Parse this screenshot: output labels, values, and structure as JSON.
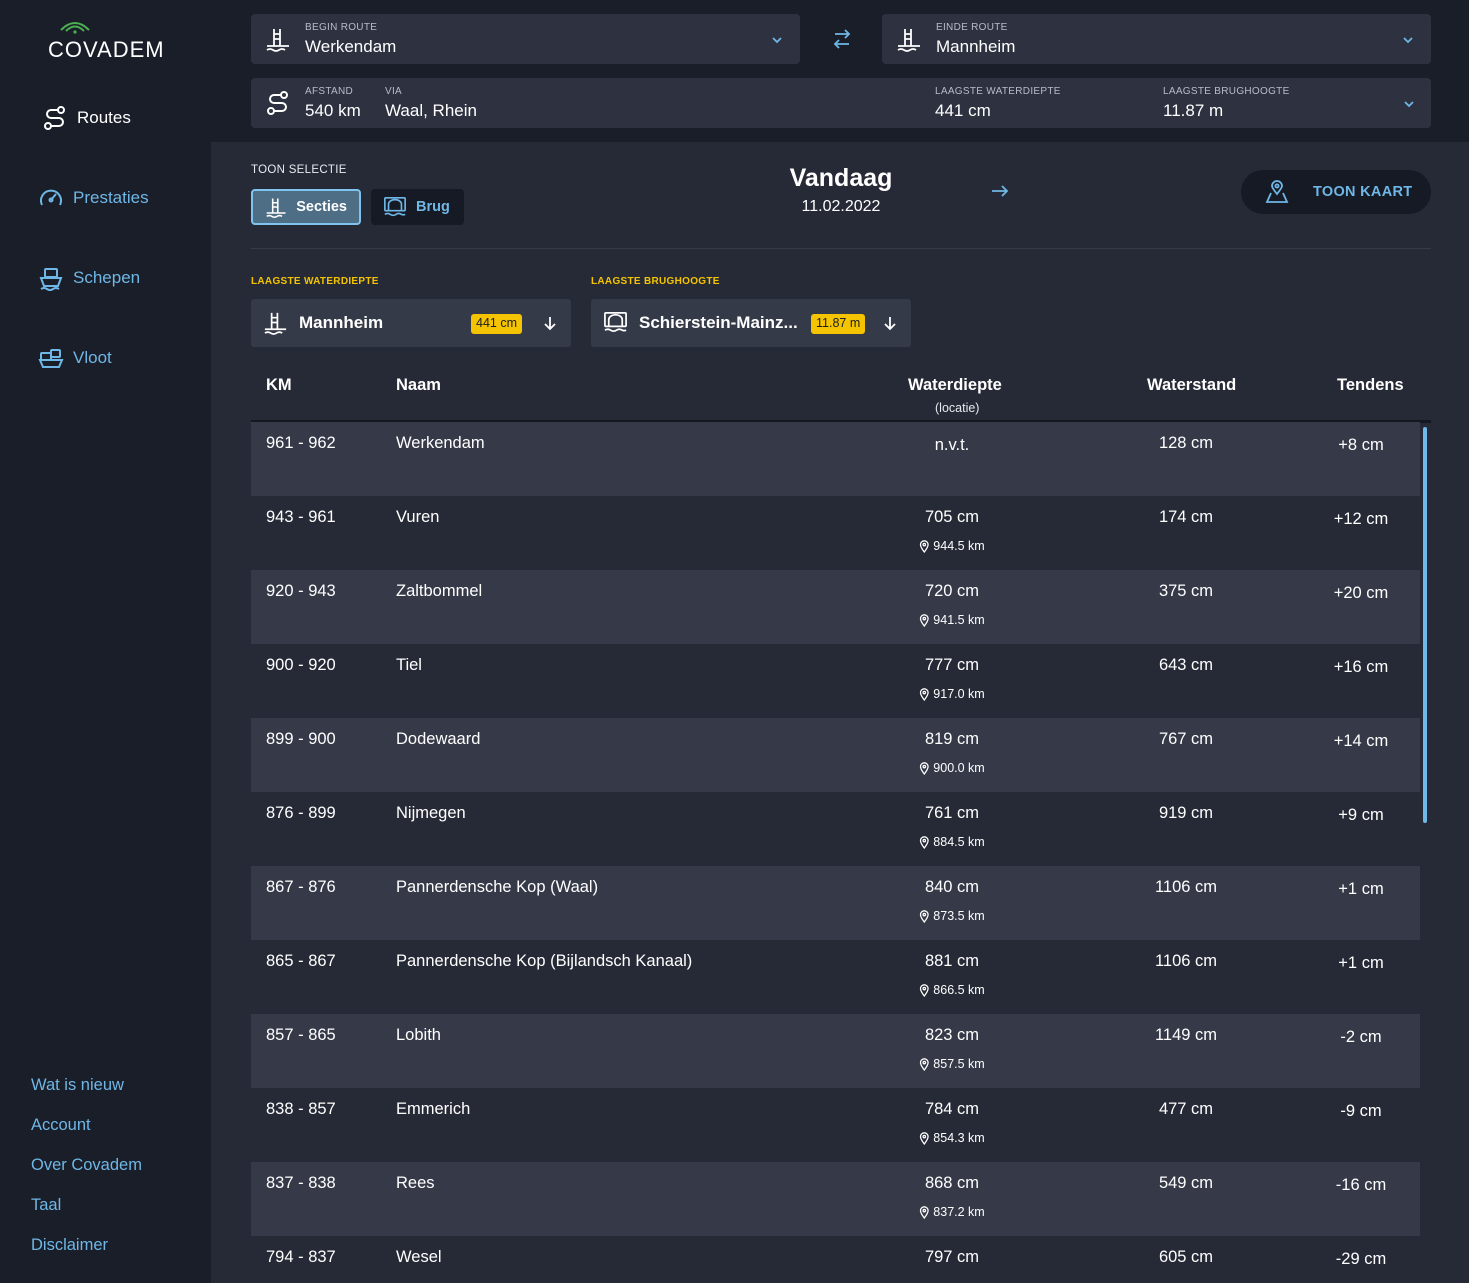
{
  "brand": {
    "logo_text": "COVADEM"
  },
  "sidebar": {
    "items": [
      {
        "label": "Routes",
        "icon": "route-icon",
        "active": true
      },
      {
        "label": "Prestaties",
        "icon": "speedometer-icon",
        "active": false
      },
      {
        "label": "Schepen",
        "icon": "ship-icon",
        "active": false
      },
      {
        "label": "Vloot",
        "icon": "fleet-icon",
        "active": false
      }
    ],
    "footer": [
      "Wat is nieuw",
      "Account",
      "Over Covadem",
      "Taal",
      "Disclaimer"
    ]
  },
  "route": {
    "begin_label": "BEGIN ROUTE",
    "begin_value": "Werkendam",
    "end_label": "EINDE ROUTE",
    "end_value": "Mannheim",
    "distance_label": "AFSTAND",
    "distance_value": "540 km",
    "via_label": "VIA",
    "via_value": "Waal, Rhein",
    "min_depth_label": "LAAGSTE WATERDIEPTE",
    "min_depth_value": "441 cm",
    "min_bridge_label": "LAAGSTE BRUGHOOGTE",
    "min_bridge_value": "11.87 m"
  },
  "toolbar": {
    "toon_selectie": "TOON SELECTIE",
    "tab_secties": "Secties",
    "tab_brug": "Brug",
    "date_title": "Vandaag",
    "date_value": "11.02.2022",
    "map_button": "TOON KAART"
  },
  "lowest": {
    "depth_label": "LAAGSTE WATERDIEPTE",
    "depth_name": "Mannheim",
    "depth_badge": "441 cm",
    "bridge_label": "LAAGSTE BRUGHOOGTE",
    "bridge_name": "Schierstein-Mainz...",
    "bridge_badge": "11.87 m"
  },
  "table": {
    "headers": {
      "km": "KM",
      "naam": "Naam",
      "waterdiepte": "Waterdiepte",
      "waterdiepte_sub": "(locatie)",
      "waterstand": "Waterstand",
      "tendens": "Tendens"
    },
    "rows": [
      {
        "km": "961 - 962",
        "naam": "Werkendam",
        "diepte": "n.v.t.",
        "locatie": "",
        "stand": "128 cm",
        "tendens": "+8 cm"
      },
      {
        "km": "943 - 961",
        "naam": "Vuren",
        "diepte": "705 cm",
        "locatie": "944.5 km",
        "stand": "174 cm",
        "tendens": "+12 cm"
      },
      {
        "km": "920 - 943",
        "naam": "Zaltbommel",
        "diepte": "720 cm",
        "locatie": "941.5 km",
        "stand": "375 cm",
        "tendens": "+20 cm"
      },
      {
        "km": "900 - 920",
        "naam": "Tiel",
        "diepte": "777 cm",
        "locatie": "917.0 km",
        "stand": "643 cm",
        "tendens": "+16 cm"
      },
      {
        "km": "899 - 900",
        "naam": "Dodewaard",
        "diepte": "819 cm",
        "locatie": "900.0 km",
        "stand": "767 cm",
        "tendens": "+14 cm"
      },
      {
        "km": "876 - 899",
        "naam": "Nijmegen",
        "diepte": "761 cm",
        "locatie": "884.5 km",
        "stand": "919 cm",
        "tendens": "+9 cm"
      },
      {
        "km": "867 - 876",
        "naam": "Pannerdensche Kop (Waal)",
        "diepte": "840 cm",
        "locatie": "873.5 km",
        "stand": "1106 cm",
        "tendens": "+1 cm"
      },
      {
        "km": "865 - 867",
        "naam": "Pannerdensche Kop (Bijlandsch Kanaal)",
        "diepte": "881 cm",
        "locatie": "866.5 km",
        "stand": "1106 cm",
        "tendens": "+1 cm"
      },
      {
        "km": "857 - 865",
        "naam": "Lobith",
        "diepte": "823 cm",
        "locatie": "857.5 km",
        "stand": "1149 cm",
        "tendens": "-2 cm"
      },
      {
        "km": "838 - 857",
        "naam": "Emmerich",
        "diepte": "784 cm",
        "locatie": "854.3 km",
        "stand": "477 cm",
        "tendens": "-9 cm"
      },
      {
        "km": "837 - 838",
        "naam": "Rees",
        "diepte": "868 cm",
        "locatie": "837.2 km",
        "stand": "549 cm",
        "tendens": "-16 cm"
      },
      {
        "km": "794 - 837",
        "naam": "Wesel",
        "diepte": "797 cm",
        "locatie": "",
        "stand": "605 cm",
        "tendens": "-29 cm"
      }
    ]
  },
  "colors": {
    "accent": "#6fb7e6",
    "highlight": "#f5c400",
    "bg": "#1a1e29",
    "panel": "#262a36",
    "row_alt": "#363a48"
  }
}
